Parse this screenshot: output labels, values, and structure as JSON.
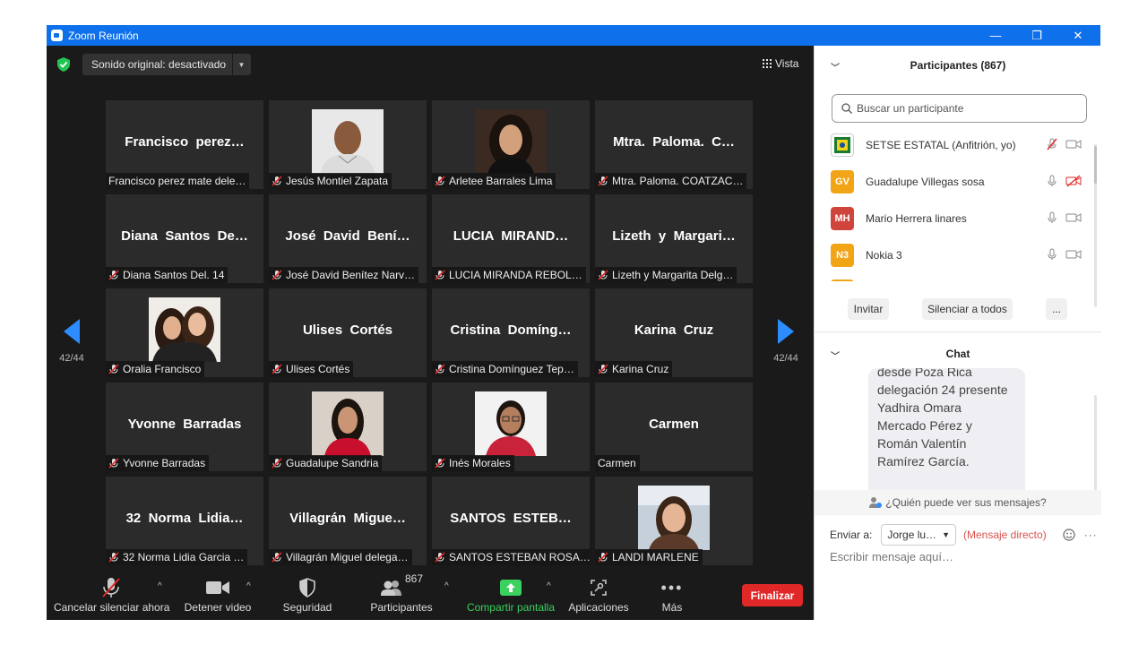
{
  "window": {
    "title": "Zoom Reunión",
    "min": "—",
    "max": "❐",
    "close": "✕"
  },
  "top": {
    "sound_label": "Sonido original: desactivado",
    "view_label": "Vista"
  },
  "pager": {
    "left": "42/44",
    "right": "42/44"
  },
  "tiles": [
    {
      "big": "Francisco  perez…",
      "label": "Francisco perez mate dele…",
      "muted": false,
      "photo": null
    },
    {
      "big": "",
      "label": "Jesús Montiel Zapata",
      "muted": true,
      "photo": "man"
    },
    {
      "big": "",
      "label": "Arletee Barrales Lima",
      "muted": true,
      "photo": "woman-dark"
    },
    {
      "big": "Mtra.  Paloma.  C…",
      "label": "Mtra. Paloma. COATZAC…",
      "muted": true,
      "photo": null
    },
    {
      "big": "Diana  Santos  De…",
      "label": "Diana Santos Del. 14",
      "muted": true,
      "photo": null
    },
    {
      "big": "José  David  Bení…",
      "label": "José David Benítez Narv…",
      "muted": true,
      "photo": null
    },
    {
      "big": "LUCIA  MIRAND…",
      "label": "LUCIA MIRANDA REBOL…",
      "muted": true,
      "photo": null
    },
    {
      "big": "Lizeth  y  Margari…",
      "label": "Lizeth y Margarita Delg…",
      "muted": true,
      "photo": null
    },
    {
      "big": "",
      "label": "Oralia Francisco",
      "muted": true,
      "photo": "two-women"
    },
    {
      "big": "Ulises  Cortés",
      "label": "Ulises Cortés",
      "muted": true,
      "photo": null
    },
    {
      "big": "Cristina  Domíng…",
      "label": "Cristina Domínguez Tep…",
      "muted": true,
      "photo": null
    },
    {
      "big": "Karina  Cruz",
      "label": "Karina Cruz",
      "muted": true,
      "photo": null
    },
    {
      "big": "Yvonne  Barradas",
      "label": "Yvonne Barradas",
      "muted": true,
      "photo": null
    },
    {
      "big": "",
      "label": "Guadalupe Sandria",
      "muted": true,
      "photo": "woman-red"
    },
    {
      "big": "",
      "label": "Inés Morales",
      "muted": true,
      "photo": "woman-glasses"
    },
    {
      "big": "Carmen",
      "label": "Carmen",
      "muted": false,
      "photo": null
    },
    {
      "big": "32  Norma  Lidia…",
      "label": "32 Norma Lidia Garcia …",
      "muted": true,
      "photo": null
    },
    {
      "big": "Villagrán  Migue…",
      "label": "Villagrán Miguel delega…",
      "muted": true,
      "photo": null
    },
    {
      "big": "SANTOS  ESTEB…",
      "label": "SANTOS ESTEBAN ROSA…",
      "muted": true,
      "photo": null
    },
    {
      "big": "",
      "label": "LANDI MARLENE",
      "muted": true,
      "photo": "woman-winter"
    }
  ],
  "toolbar": {
    "mute_label": "Cancelar silenciar ahora",
    "video_label": "Detener video",
    "security_label": "Seguridad",
    "participants_label": "Participantes",
    "participants_count": "867",
    "share_label": "Compartir pantalla",
    "apps_label": "Aplicaciones",
    "more_label": "Más",
    "end_label": "Finalizar",
    "share_color": "#3ad15f",
    "end_color": "#e02828"
  },
  "participants": {
    "header": "Participantes (867)",
    "search_placeholder": "Buscar un participante",
    "list": [
      {
        "initials": "",
        "name": "SETSE ESTATAL (Anfitrión, yo)",
        "color": "#ffffff",
        "mic_muted": true,
        "video_off": false,
        "logo": true
      },
      {
        "initials": "GV",
        "name": "Guadalupe Villegas sosa",
        "color": "#f2a417",
        "mic_muted": false,
        "video_off": true,
        "logo": false
      },
      {
        "initials": "MH",
        "name": "Mario Herrera linares",
        "color": "#d0453b",
        "mic_muted": false,
        "video_off": false,
        "logo": false
      },
      {
        "initials": "N3",
        "name": "Nokia 3",
        "color": "#f2a417",
        "mic_muted": false,
        "video_off": false,
        "logo": false
      }
    ],
    "invite_label": "Invitar",
    "mute_all_label": "Silenciar a todos",
    "more_label": "..."
  },
  "chat": {
    "header": "Chat",
    "message_lines": [
      "desde Poza Rica",
      "delegación 24 presente",
      "Yadhira Omara",
      "Mercado Pérez y",
      "Román Valentín",
      "Ramírez García."
    ],
    "who_can_see": "¿Quién puede ver sus mensajes?",
    "send_to_label": "Enviar a:",
    "recipient": "Jorge lu…",
    "direct_label": "(Mensaje directo)",
    "compose_placeholder": "Escribir mensaje aquí…"
  }
}
